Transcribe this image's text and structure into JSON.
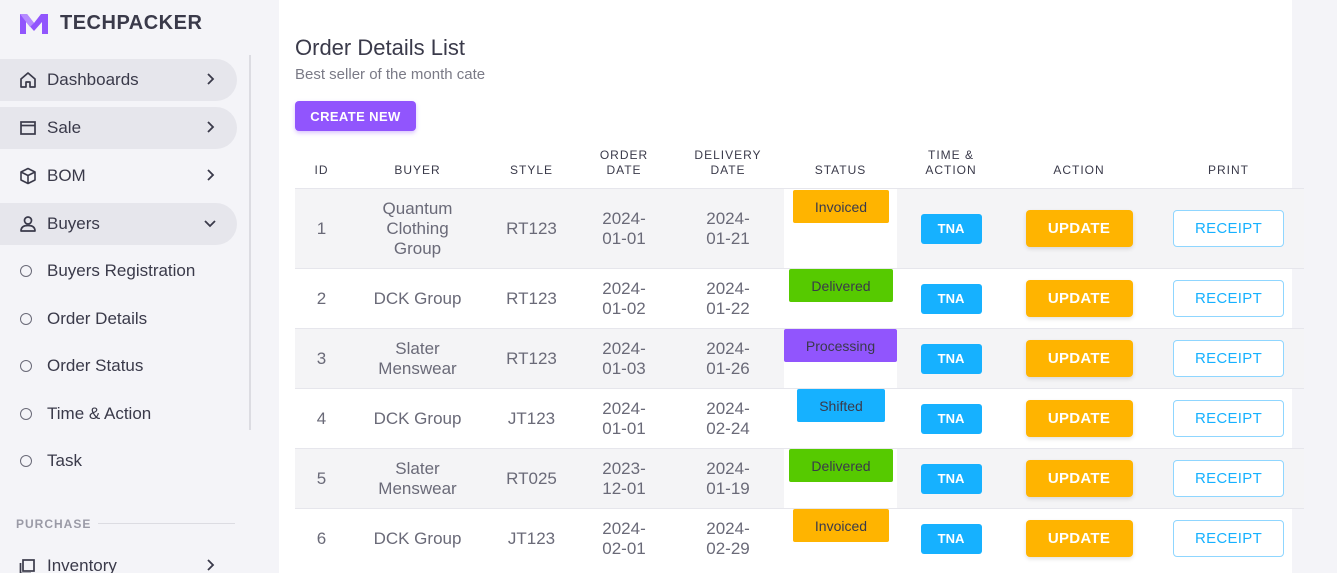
{
  "brand": {
    "name": "TECHPACKER"
  },
  "sidebar": {
    "nav": [
      {
        "label": "Dashboards",
        "icon": "home-icon",
        "expanded": false
      },
      {
        "label": "Sale",
        "icon": "window-icon",
        "expanded": false
      },
      {
        "label": "BOM",
        "icon": "cube-icon",
        "expanded": false
      },
      {
        "label": "Buyers",
        "icon": "user-icon",
        "expanded": true
      }
    ],
    "sub_items": [
      {
        "label": "Buyers Registration"
      },
      {
        "label": "Order Details"
      },
      {
        "label": "Order Status"
      },
      {
        "label": "Time & Action"
      },
      {
        "label": "Task"
      }
    ],
    "section_label": "PURCHASE",
    "inventory": {
      "label": "Inventory",
      "icon": "inventory-icon"
    }
  },
  "main": {
    "title": "Order Details List",
    "subtitle": "Best seller of the month cate",
    "create_button": "CREATE NEW"
  },
  "table": {
    "headers": {
      "id": "ID",
      "buyer": "BUYER",
      "style": "STYLE",
      "order_date_1": "ORDER",
      "order_date_2": "DATE",
      "delivery_date_1": "DELIVERY",
      "delivery_date_2": "DATE",
      "status": "STATUS",
      "tna_1": "TIME &",
      "tna_2": "ACTION",
      "action": "ACTION",
      "print": "PRINT"
    },
    "rows": [
      {
        "id": "1",
        "buyer": "Quantum Clothing Group",
        "style": "RT123",
        "order_date": "2024-01-01",
        "delivery_date": "2024-01-21",
        "status": "Invoiced",
        "tna": "TNA",
        "update": "UPDATE",
        "receipt": "RECEIPT"
      },
      {
        "id": "2",
        "buyer": "DCK Group",
        "style": "RT123",
        "order_date": "2024-01-02",
        "delivery_date": "2024-01-22",
        "status": "Delivered",
        "tna": "TNA",
        "update": "UPDATE",
        "receipt": "RECEIPT"
      },
      {
        "id": "3",
        "buyer": "Slater Menswear",
        "style": "RT123",
        "order_date": "2024-01-03",
        "delivery_date": "2024-01-26",
        "status": "Processing",
        "tna": "TNA",
        "update": "UPDATE",
        "receipt": "RECEIPT"
      },
      {
        "id": "4",
        "buyer": "DCK Group",
        "style": "JT123",
        "order_date": "2024-01-01",
        "delivery_date": "2024-02-24",
        "status": "Shifted",
        "tna": "TNA",
        "update": "UPDATE",
        "receipt": "RECEIPT"
      },
      {
        "id": "5",
        "buyer": "Slater Menswear",
        "style": "RT025",
        "order_date": "2023-12-01",
        "delivery_date": "2024-01-19",
        "status": "Delivered",
        "tna": "TNA",
        "update": "UPDATE",
        "receipt": "RECEIPT"
      },
      {
        "id": "6",
        "buyer": "DCK Group",
        "style": "JT123",
        "order_date": "2024-02-01",
        "delivery_date": "2024-02-29",
        "status": "Invoiced",
        "tna": "TNA",
        "update": "UPDATE",
        "receipt": "RECEIPT"
      }
    ]
  },
  "colors": {
    "primary": "#9155fd",
    "invoiced": "#ffb400",
    "delivered": "#56ca00",
    "processing": "#9155fd",
    "shifted": "#16b1ff",
    "update": "#ffb400",
    "info": "#16b1ff"
  }
}
